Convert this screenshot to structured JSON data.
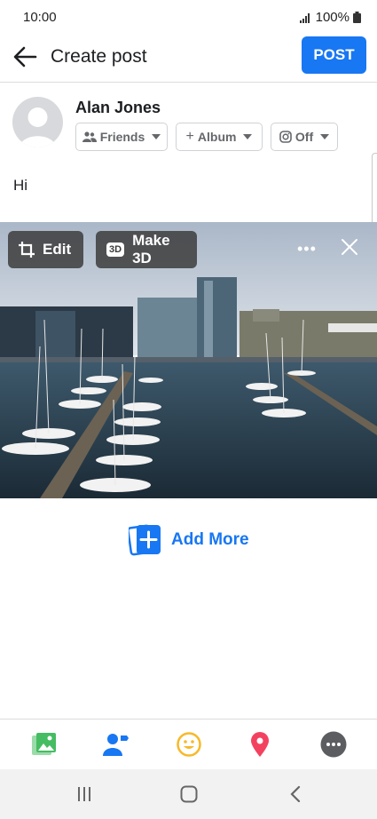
{
  "status_bar": {
    "time": "10:00",
    "battery": "100%"
  },
  "header": {
    "title": "Create post",
    "post_label": "POST"
  },
  "profile": {
    "name": "Alan Jones",
    "audience_label": "Friends",
    "album_label": "Album",
    "instagram_label": "Off"
  },
  "composer": {
    "text": "Hi"
  },
  "photo": {
    "edit_label": "Edit",
    "make3d_label": "Make 3D",
    "make3d_badge": "3D",
    "more_glyph": "•••"
  },
  "add_more": {
    "label": "Add More"
  },
  "toolbar": {
    "items": [
      "photo-icon",
      "tag-people-icon",
      "feeling-icon",
      "location-icon",
      "more-icon"
    ]
  },
  "colors": {
    "accent": "#1877f2",
    "photo_green": "#45bd62",
    "feeling_yellow": "#f7b928",
    "location_red": "#f3425f"
  }
}
